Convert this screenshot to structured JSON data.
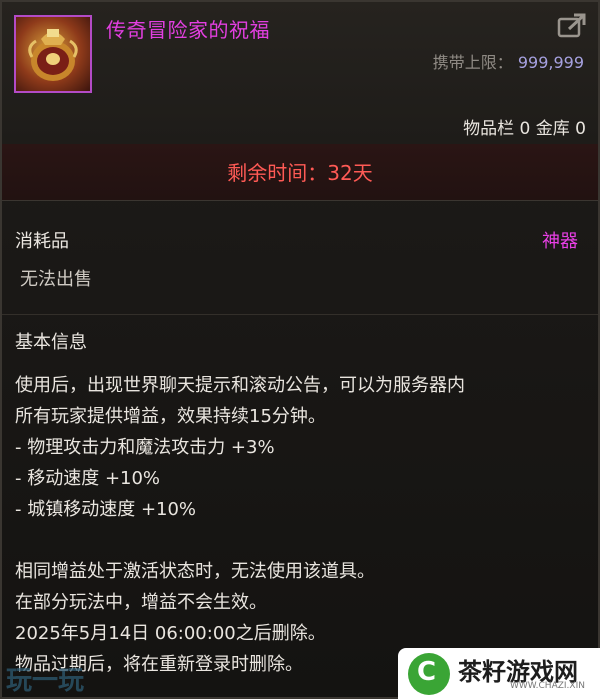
{
  "item": {
    "name": "传奇冒险家的祝福",
    "icon": "legendary-urn-icon",
    "carry_label": "携带上限：",
    "carry_value": "999,999",
    "storage": "物品栏 0 金库 0"
  },
  "timer": {
    "text": "剩余时间：32天"
  },
  "meta": {
    "category": "消耗品",
    "rarity": "神器",
    "tradable": "无法出售"
  },
  "info": {
    "title": "基本信息",
    "lines": [
      "使用后，出现世界聊天提示和滚动公告，可以为服务器内",
      "所有玩家提供增益，效果持续15分钟。",
      "- 物理攻击力和魔法攻击力 +3%",
      "- 移动速度 +10%",
      "- 城镇移动速度 +10%",
      "",
      "相同增益处于激活状态时，无法使用该道具。",
      "在部分玩法中，增益不会生效。",
      "2025年5月14日 06:00:00之后删除。",
      "物品过期后，将在重新登录时删除。"
    ]
  },
  "watermark": {
    "left": "玩一玩",
    "logo": "C",
    "name": "茶籽游戏网",
    "url": "WWW.CHAZI.XIN"
  },
  "colors": {
    "rarity": "#e83fe5",
    "timer": "#ff5a55",
    "carry_value": "#a6a1e0"
  }
}
